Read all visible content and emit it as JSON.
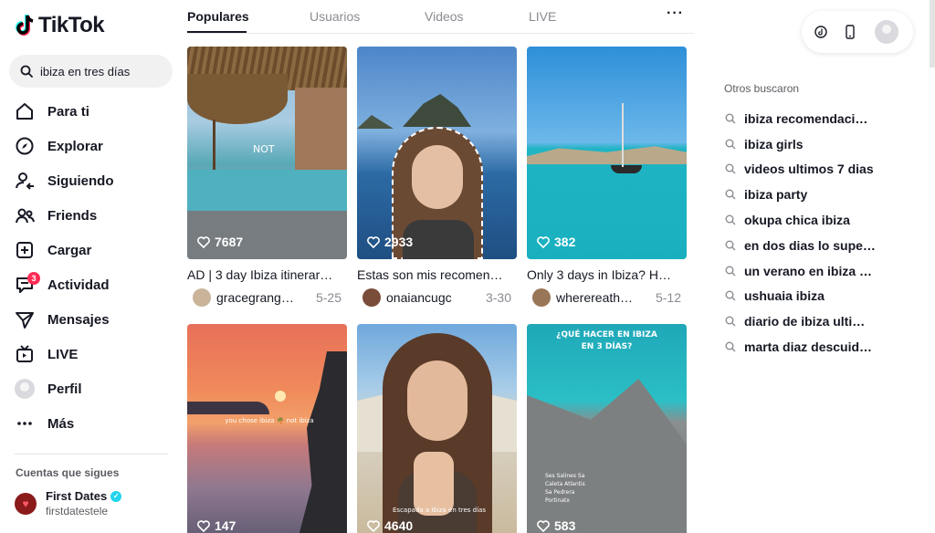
{
  "app": {
    "logo_text": "TikTok"
  },
  "search": {
    "value": "ibiza en tres días"
  },
  "nav": {
    "items": [
      {
        "label": "Para ti",
        "icon": "home-icon"
      },
      {
        "label": "Explorar",
        "icon": "compass-icon"
      },
      {
        "label": "Siguiendo",
        "icon": "following-icon"
      },
      {
        "label": "Friends",
        "icon": "friends-icon"
      },
      {
        "label": "Cargar",
        "icon": "upload-icon"
      },
      {
        "label": "Actividad",
        "icon": "activity-icon",
        "badge": "3"
      },
      {
        "label": "Mensajes",
        "icon": "messages-icon"
      },
      {
        "label": "LIVE",
        "icon": "live-icon"
      },
      {
        "label": "Perfil",
        "icon": "profile-avatar"
      },
      {
        "label": "Más",
        "icon": "more-icon"
      }
    ]
  },
  "following": {
    "title": "Cuentas que sigues",
    "accounts": [
      {
        "name": "First Dates",
        "handle": "firstdatestele",
        "verified": true
      }
    ]
  },
  "tabs": {
    "items": [
      "Populares",
      "Usuarios",
      "Videos",
      "LIVE"
    ],
    "active": "Populares"
  },
  "videos": [
    {
      "likes": "7687",
      "caption": "AD | 3 day Ibiza itinerar…",
      "user": "gracegrang…",
      "date": "5-25",
      "overlay": "NOT"
    },
    {
      "likes": "2933",
      "caption": "Estas son mis recomen…",
      "user": "onaiancugc",
      "date": "3-30"
    },
    {
      "likes": "382",
      "caption": "Only 3 days in Ibiza? H…",
      "user": "wherereath…",
      "date": "5-12"
    },
    {
      "likes": "147",
      "overlay": "you chose ibiza 🌴 not ibiza"
    },
    {
      "likes": "4640",
      "overlay": "Escapada a Ibiza en tres días"
    },
    {
      "likes": "583",
      "overlay": "¿QUÉ HACER EN IBIZA EN 3 DÍAS?",
      "overlay2": "Ses Salines Sa Caleta Atlantis Sa Pedrera Portinatx"
    }
  ],
  "suggestions": {
    "title": "Otros buscaron",
    "items": [
      "ibiza recomendaci…",
      "ibiza girls",
      "videos ultimos 7 dias",
      "ibiza party",
      "okupa chica ibiza",
      "en dos dias lo supe…",
      "un verano en ibiza …",
      "ushuaia ibiza",
      "diario de ibiza ulti…",
      "marta diaz descuid…"
    ]
  },
  "colors": {
    "accent": "#fe2c55",
    "text": "#161823",
    "muted": "#8a8b91",
    "cyan": "#20d5ec"
  }
}
